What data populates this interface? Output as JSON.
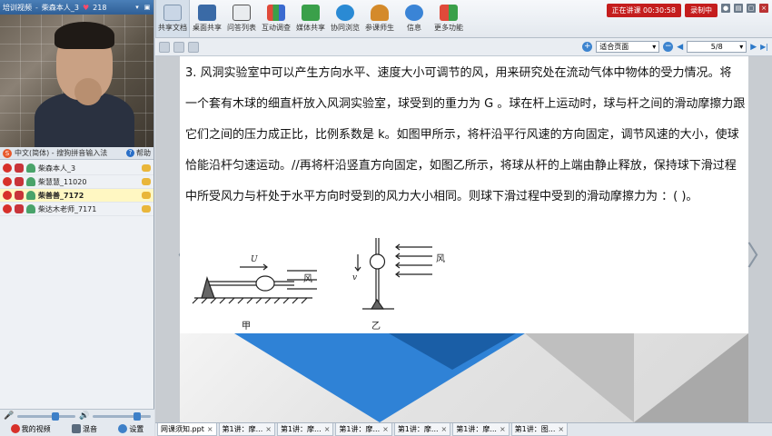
{
  "window": {
    "title": "培训视频",
    "sep": "-",
    "user": "柴森本人_3",
    "likes": "218"
  },
  "ime": {
    "label": "中文(简体) - 搜狗拼音输入法",
    "help": "帮助"
  },
  "users": [
    {
      "name": "柴森本人_3",
      "selected": false
    },
    {
      "name": "柴慧慧_11020",
      "selected": false
    },
    {
      "name": "柴善善_7172",
      "selected": true
    },
    {
      "name": "柴达木老师_7171",
      "selected": false
    }
  ],
  "bottom_actions": {
    "video": "我的视频",
    "mix": "混音",
    "settings": "设置"
  },
  "toolbar": {
    "items": [
      "共享文档",
      "桌面共享",
      "问答列表",
      "互动调查",
      "媒体共享",
      "协同浏览",
      "参课师生",
      "信息",
      "更多功能"
    ],
    "live_label": "正在讲课 00:30:58",
    "record_label": "录制中"
  },
  "doc_toolbar": {
    "fit_label": "适合页面",
    "page_label": "5/8"
  },
  "question": {
    "lines": [
      "3. 风洞实验室中可以产生方向水平、速度大小可调节的风，用来研究处在流动气体中物体的受力情况。将",
      "一个套有木球的细直杆放入风洞实验室，球受到的重力为 G 。球在杆上运动时，球与杆之间的滑动摩擦力跟",
      "它们之间的压力成正比，比例系数是 k。如图甲所示，将杆沿平行风速的方向固定，调节风速的大小，使球",
      "恰能沿杆匀速运动。//再将杆沿竖直方向固定，如图乙所示，将球从杆的上端由静止释放，保持球下滑过程",
      "中所受风力与杆处于水平方向时受到的风力大小相同。则球下滑过程中受到的滑动摩擦力为 ：(    )。"
    ],
    "fig_labels": {
      "u": "U",
      "wind1": "风",
      "wind2": "风",
      "v": "v",
      "jia": "甲",
      "yi": "乙"
    }
  },
  "tabs": [
    {
      "label": "网课须知.ppt",
      "active": true
    },
    {
      "label": "第1讲：摩...",
      "active": false
    },
    {
      "label": "第1讲：摩...",
      "active": false
    },
    {
      "label": "第1讲：摩...",
      "active": false
    },
    {
      "label": "第1讲：摩...",
      "active": false
    },
    {
      "label": "第1讲：摩...",
      "active": false
    },
    {
      "label": "第1讲：图...",
      "active": false
    }
  ]
}
